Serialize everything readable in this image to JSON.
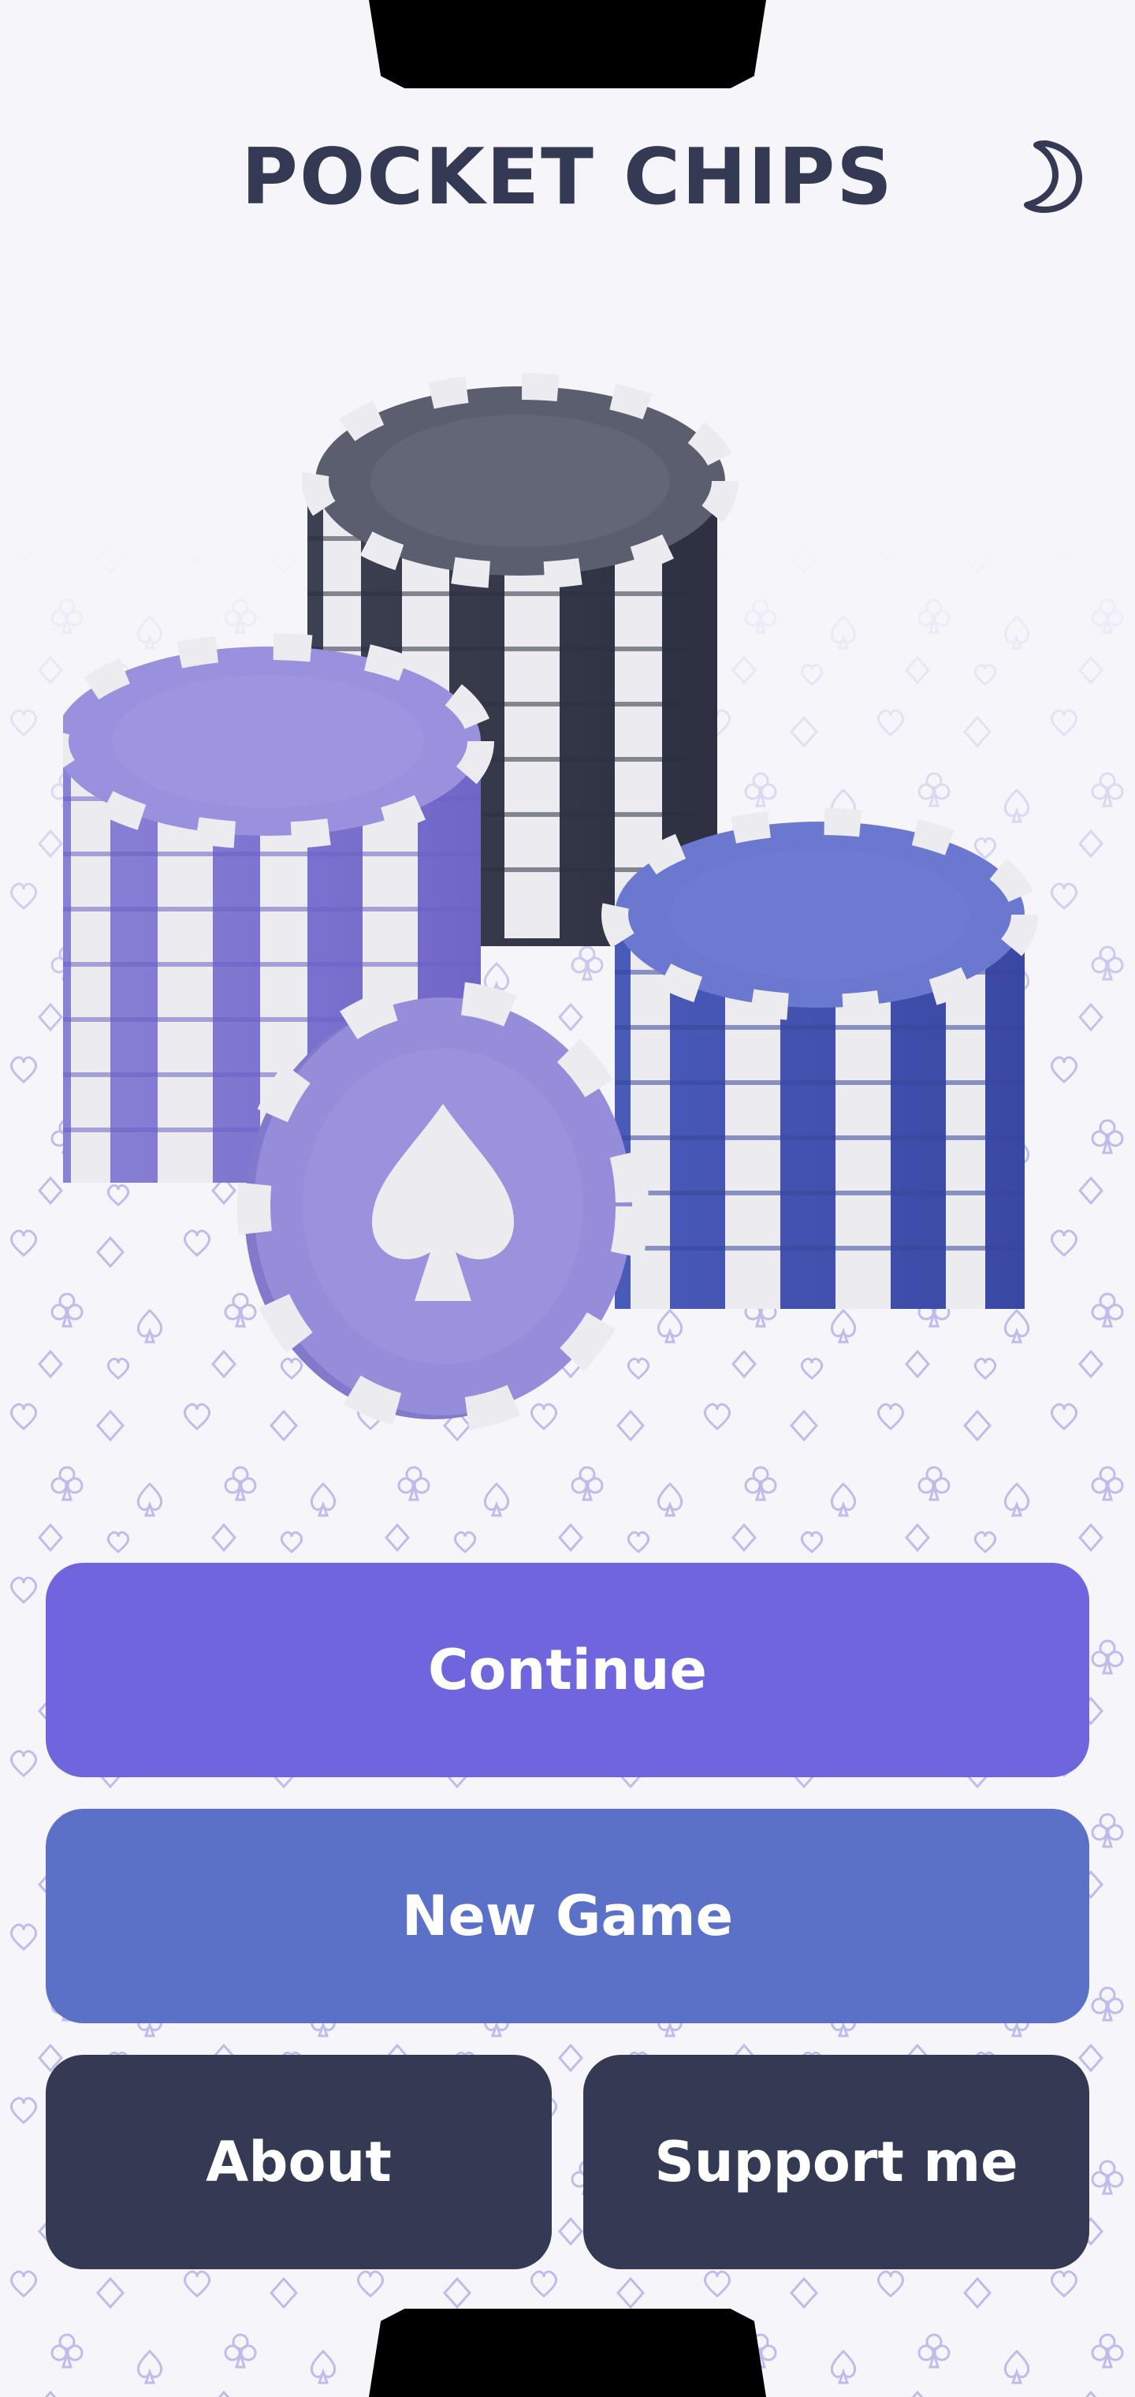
{
  "app": {
    "title": "POCKET CHIPS"
  },
  "icons": {
    "theme_toggle": "crescent-moon-icon",
    "background_pattern": [
      "heart",
      "club",
      "diamond",
      "spade"
    ],
    "hero_image": "poker-chip-stacks"
  },
  "menu": {
    "continue_label": "Continue",
    "new_game_label": "New Game",
    "about_label": "About",
    "support_label": "Support me"
  },
  "colors": {
    "background": "#f6f6fa",
    "title": "#353a54",
    "continue": "#6f66de",
    "new_game": "#5b71c8",
    "secondary": "#353a54",
    "chip_purple": "#8f86d8",
    "chip_blue": "#5a6cc8",
    "chip_dark": "#454a5a",
    "chip_white": "#ececf0"
  }
}
